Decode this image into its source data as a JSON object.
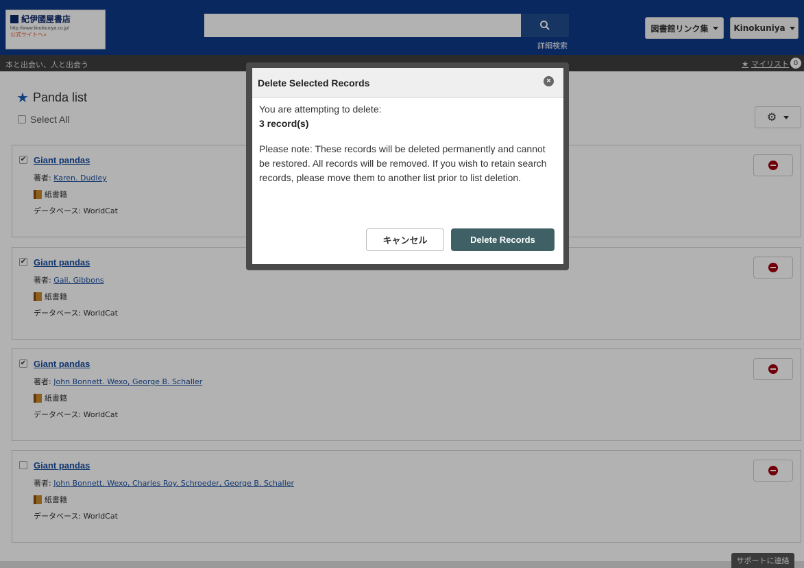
{
  "header": {
    "logo_name": "紀伊國屋書店",
    "logo_url": "http://www.kinokuniya.co.jp/",
    "logo_link": "公式サイトへ»",
    "search_placeholder": "",
    "advanced_search": "詳細検索",
    "library_links": "図書館リンク集",
    "user_menu": "Kinokuniya"
  },
  "subbar": {
    "tagline": "本と出会い、人と出会う",
    "mylist": "マイリスト",
    "mylist_count": "0"
  },
  "list": {
    "title": "Panda list",
    "select_all": "Select All"
  },
  "records": [
    {
      "checked": "✔",
      "title": "Giant pandas",
      "author_label": "著者:",
      "authors": "Karen. Dudley",
      "format": "紙書籍",
      "db": "データベース: WorldCat"
    },
    {
      "checked": "✔",
      "title": "Giant pandas",
      "author_label": "著者:",
      "authors": "Gail. Gibbons",
      "format": "紙書籍",
      "db": "データベース: WorldCat"
    },
    {
      "checked": "✔",
      "title": "Giant pandas",
      "author_label": "著者:",
      "authors": "John Bonnett. Wexo, George B. Schaller",
      "format": "紙書籍",
      "db": "データベース: WorldCat"
    },
    {
      "checked": "",
      "title": "Giant pandas",
      "author_label": "著者:",
      "authors": "John Bonnett. Wexo, Charles Roy. Schroeder, George B. Schaller",
      "format": "紙書籍",
      "db": "データベース: WorldCat"
    }
  ],
  "modal": {
    "title": "Delete Selected Records",
    "intro": "You are attempting to delete:",
    "count": "3 record(s)",
    "note": "Please note: These records will be deleted permanently and cannot be restored. All records will be removed. If you wish to retain search records, please move them to another list prior to list deletion.",
    "cancel": "キャンセル",
    "delete": "Delete Records"
  },
  "footer": {
    "support": "サポートに連絡"
  }
}
